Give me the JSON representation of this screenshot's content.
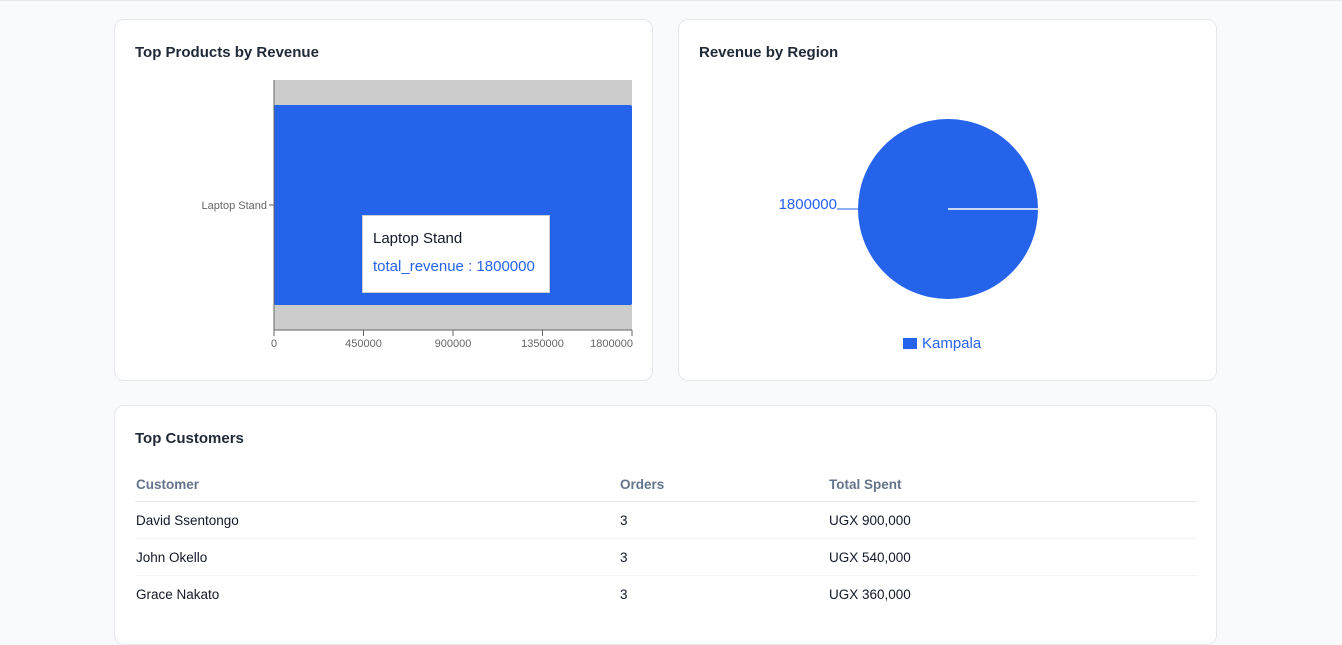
{
  "products_card": {
    "title": "Top Products by Revenue",
    "tooltip": {
      "label": "Laptop Stand",
      "series_key": "total_revenue",
      "separator": " : ",
      "value": "1800000"
    }
  },
  "region_card": {
    "title": "Revenue by Region",
    "slice_label": "1800000",
    "legend": [
      {
        "name": "Kampala",
        "color": "#2563eb"
      }
    ]
  },
  "customers_card": {
    "title": "Top Customers",
    "columns": [
      "Customer",
      "Orders",
      "Total Spent"
    ],
    "rows": [
      {
        "customer": "David Ssentongo",
        "orders": "3",
        "total_spent": "UGX 900,000"
      },
      {
        "customer": "John Okello",
        "orders": "3",
        "total_spent": "UGX 540,000"
      },
      {
        "customer": "Grace Nakato",
        "orders": "3",
        "total_spent": "UGX 360,000"
      }
    ]
  },
  "colors": {
    "accent": "#2563eb",
    "highlight": "#cccccc"
  },
  "chart_data": [
    {
      "type": "bar",
      "orientation": "horizontal",
      "title": "Top Products by Revenue",
      "categories": [
        "Laptop Stand"
      ],
      "series": [
        {
          "name": "total_revenue",
          "values": [
            1800000
          ]
        }
      ],
      "xlim": [
        0,
        1800000
      ],
      "xticks": [
        0,
        450000,
        900000,
        1350000,
        1800000
      ],
      "highlighted_category": "Laptop Stand",
      "grid": false
    },
    {
      "type": "pie",
      "title": "Revenue by Region",
      "categories": [
        "Kampala"
      ],
      "values": [
        1800000
      ],
      "legend_position": "bottom"
    }
  ]
}
